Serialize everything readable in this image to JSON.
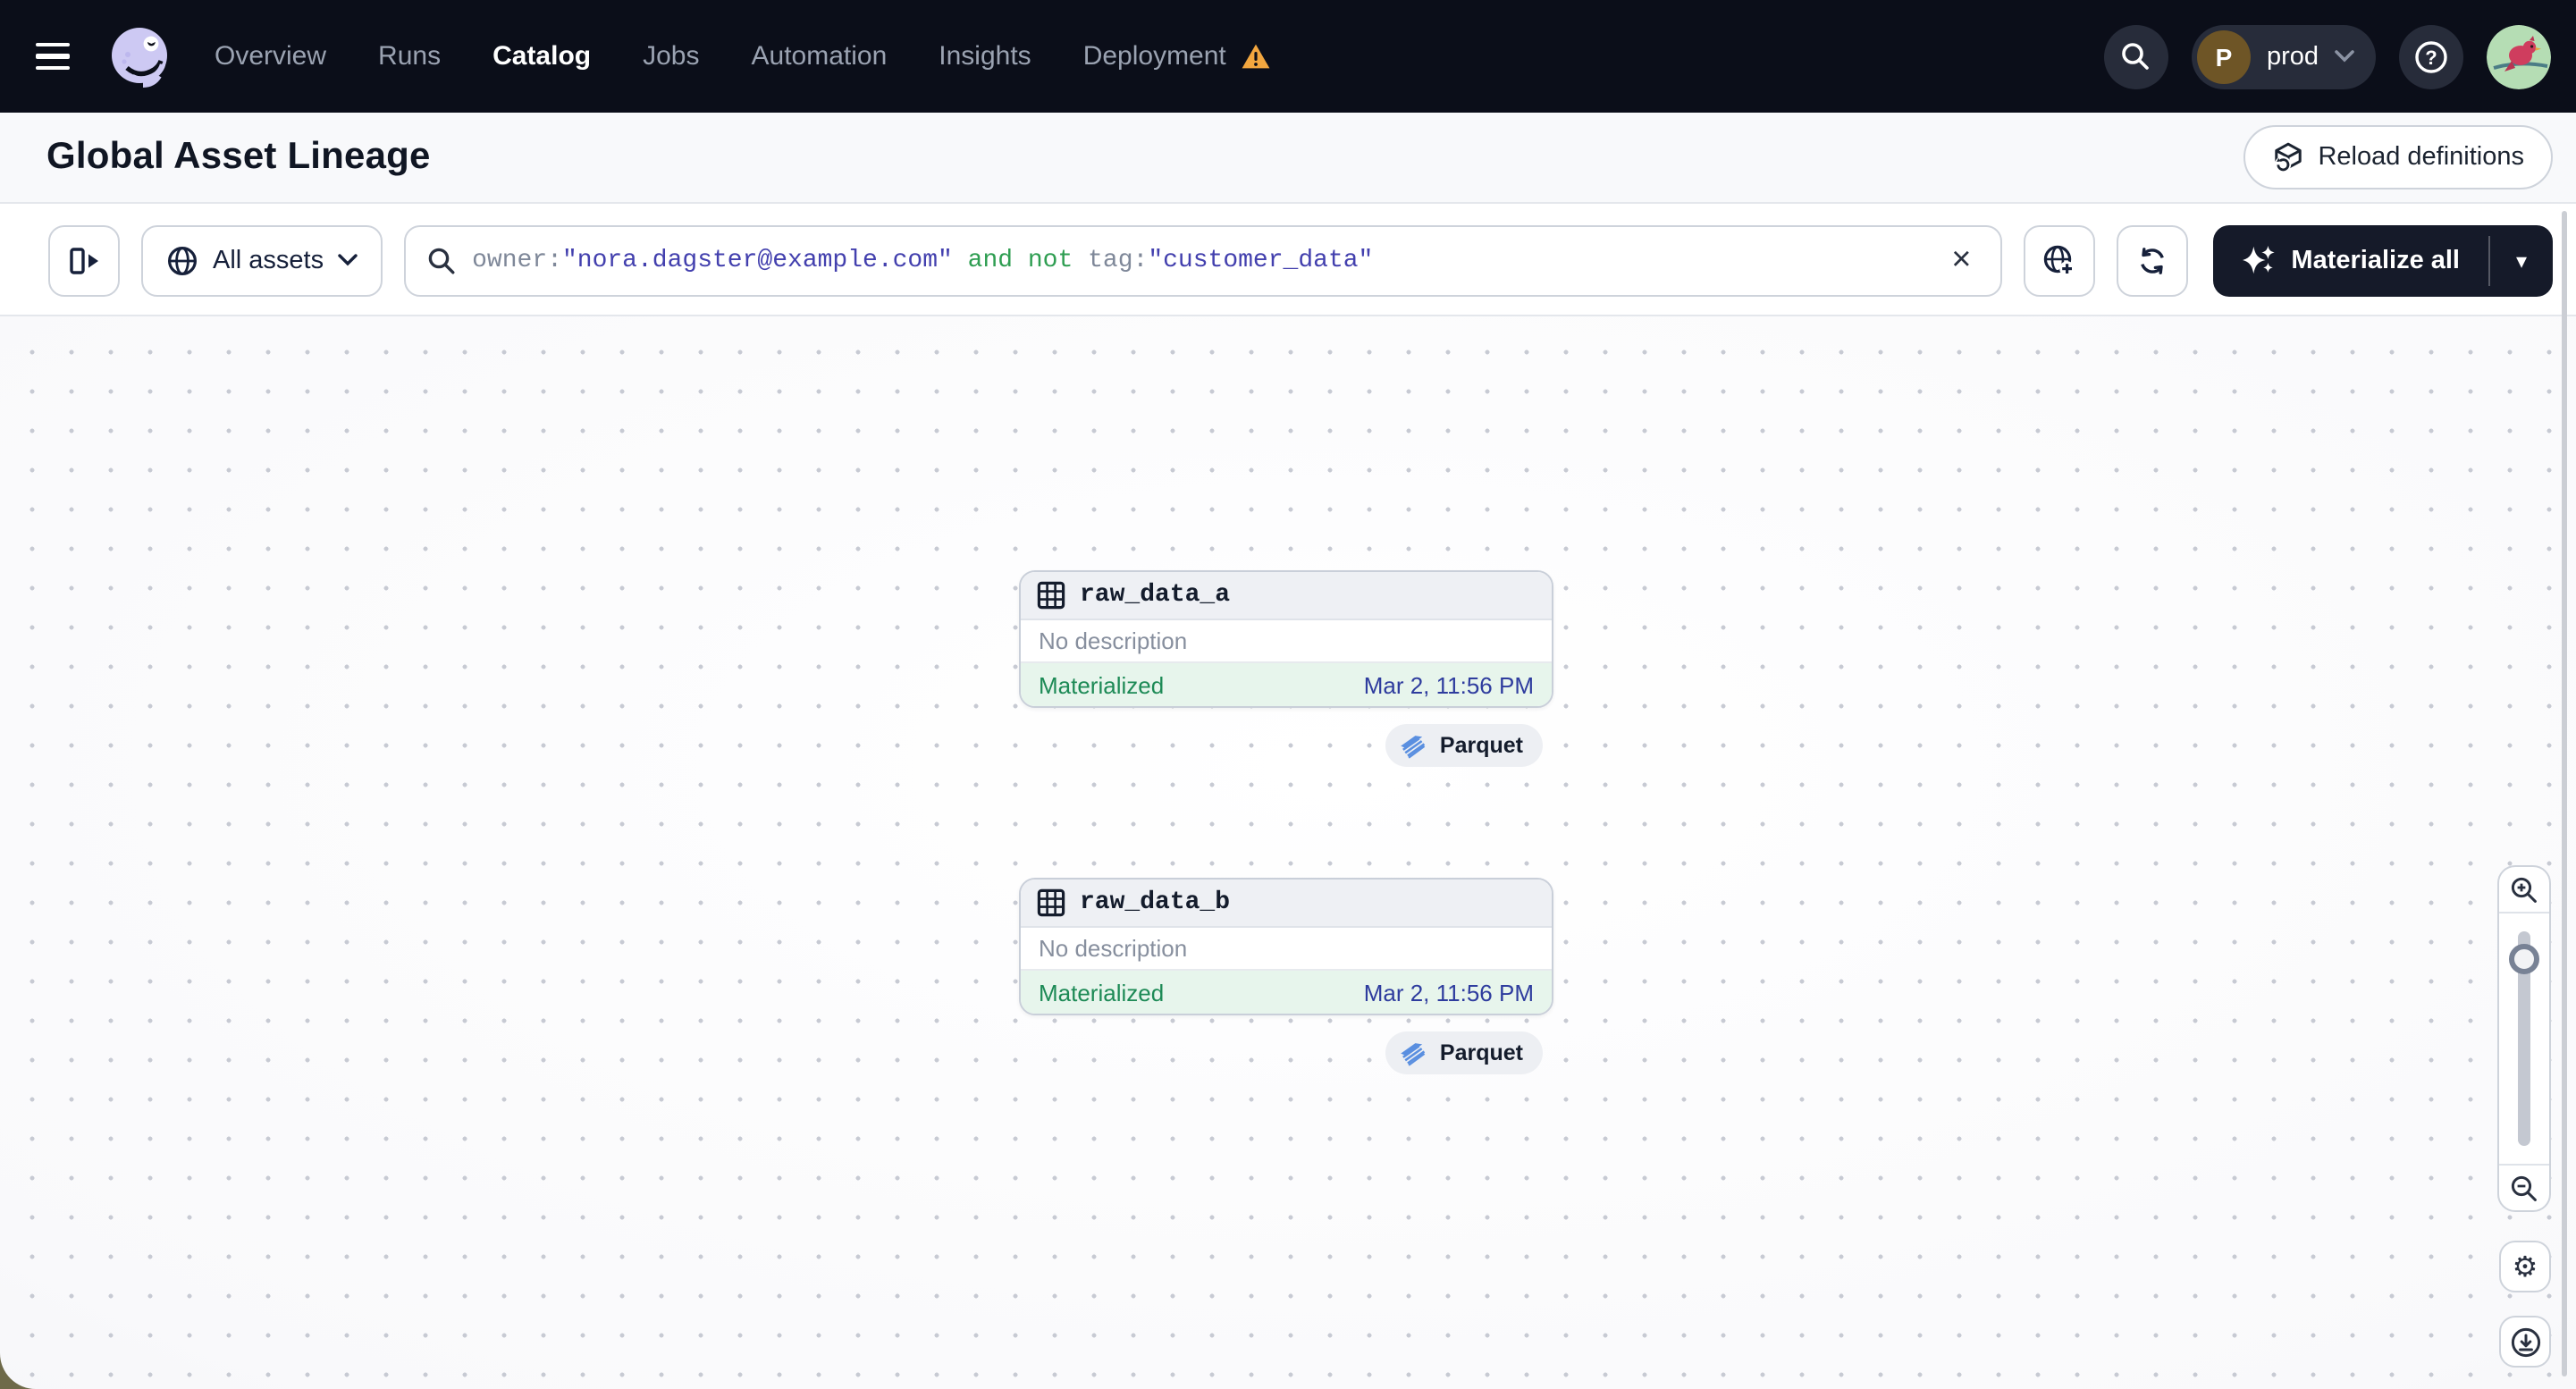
{
  "nav": {
    "items": [
      {
        "label": "Overview"
      },
      {
        "label": "Runs"
      },
      {
        "label": "Catalog",
        "active": true
      },
      {
        "label": "Jobs"
      },
      {
        "label": "Automation"
      },
      {
        "label": "Insights"
      },
      {
        "label": "Deployment",
        "warning": true
      }
    ],
    "environment": {
      "initial": "P",
      "name": "prod"
    }
  },
  "header": {
    "title": "Global Asset Lineage",
    "reload_button_label": "Reload definitions"
  },
  "toolbar": {
    "scope_selector_label": "All assets",
    "search": {
      "query_full": "owner:\"nora.dagster@example.com\" and not tag:\"customer_data\"",
      "segments": {
        "key1": "owner:",
        "value1": "\"nora.dagster@example.com\"",
        "operator": " and not ",
        "key2": "tag:",
        "value2": "\"customer_data\""
      }
    },
    "materialize_button_label": "Materialize all"
  },
  "graph": {
    "nodes": [
      {
        "name": "raw_data_a",
        "description": "No description",
        "status": "Materialized",
        "materialized_at": "Mar 2, 11:56 PM",
        "tag": "Parquet"
      },
      {
        "name": "raw_data_b",
        "description": "No description",
        "status": "Materialized",
        "materialized_at": "Mar 2, 11:56 PM",
        "tag": "Parquet"
      }
    ]
  },
  "icons": {
    "clear": "×",
    "caret_down": "▾",
    "gear": "⚙"
  },
  "colors": {
    "nav_bg": "#0b0e19",
    "status_green": "#1d8a56",
    "status_bg": "#e7f5ec",
    "timestamp_blue": "#2e3c9e",
    "query_value_indigo": "#4340ae",
    "query_operator_green": "#2f9e52",
    "warning_orange": "#f2a63f",
    "materialize_bg": "#151a29",
    "parquet_blue": "#5a8fe0"
  }
}
